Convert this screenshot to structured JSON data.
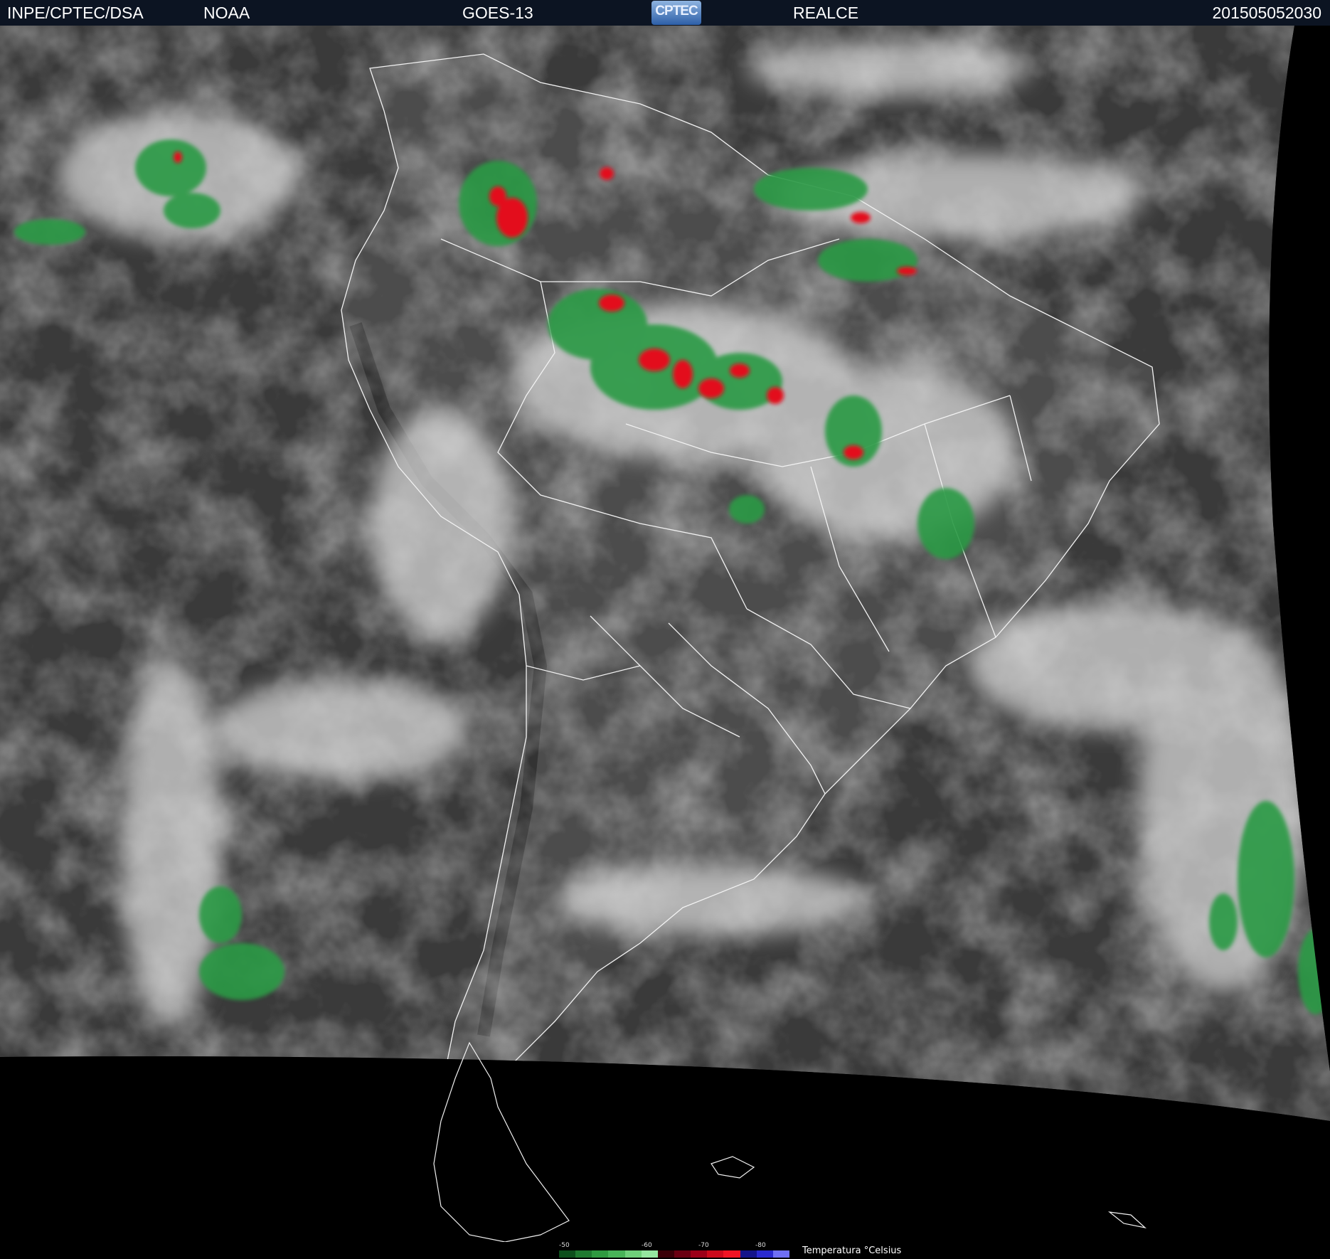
{
  "header": {
    "source": "INPE/CPTEC/DSA",
    "agency": "NOAA",
    "satellite": "GOES-13",
    "logo_text": "CPTEC",
    "mode": "REALCE",
    "timestamp": "201505052030"
  },
  "legend": {
    "title": "Temperatura °Celsius",
    "ticks": [
      "-50",
      "-60",
      "-70",
      "-80"
    ],
    "colors": [
      "#0d4f1c",
      "#1f7a30",
      "#2f9a40",
      "#48b358",
      "#6fcf7a",
      "#95e6a0",
      "#3a0008",
      "#6b0012",
      "#9c0018",
      "#cc0a1c",
      "#f01424",
      "#14148a",
      "#2a2ad0",
      "#6f6ff5"
    ]
  },
  "colors": {
    "ocean": "#3a3a3a",
    "land": "#4a4a4a",
    "cloud": "#d8d8d8",
    "border": "#ffffff"
  }
}
